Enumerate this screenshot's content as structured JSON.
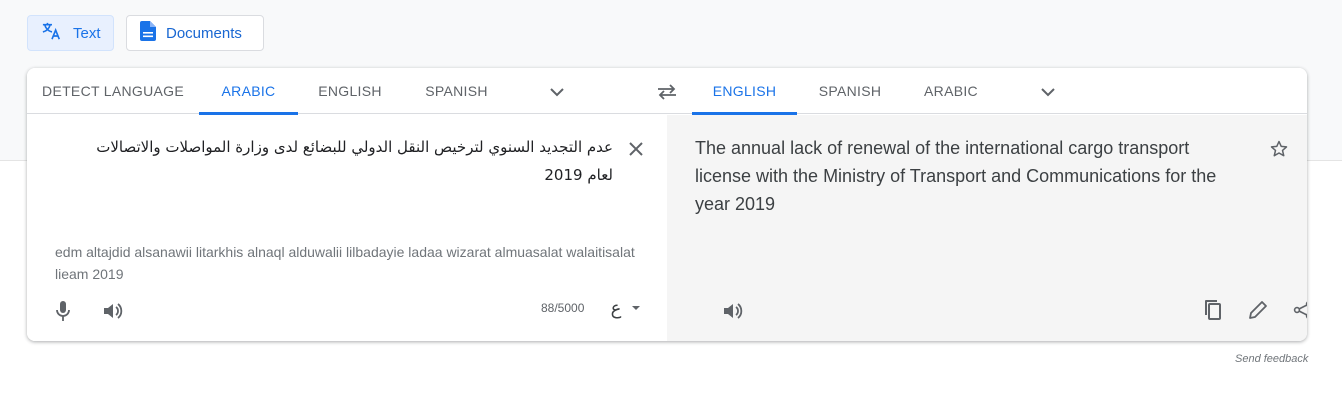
{
  "mode_buttons": {
    "text": "Text",
    "documents": "Documents"
  },
  "source_tabs": [
    "DETECT LANGUAGE",
    "ARABIC",
    "ENGLISH",
    "SPANISH"
  ],
  "target_tabs": [
    "ENGLISH",
    "SPANISH",
    "ARABIC"
  ],
  "source": {
    "text": "عدم التجديد السنوي لترخيص النقل الدولي للبضائع لدى وزارة المواصلات والاتصالات لعام 2019",
    "transliteration": "edm altajdid alsanawii litarkhis alnaql alduwalii lilbadayie ladaa wizarat almuasalat walaitisalat lieam 2019",
    "char_count": "88/5000",
    "input_tool_glyph": "ع"
  },
  "target": {
    "text": "The annual lack of renewal of the international cargo transport license with the Ministry of Transport and Communications for the year 2019"
  },
  "footer": {
    "feedback": "Send feedback"
  },
  "colors": {
    "accent": "#1a73e8",
    "icon": "#5f6368",
    "target_bg": "#f5f5f5"
  }
}
